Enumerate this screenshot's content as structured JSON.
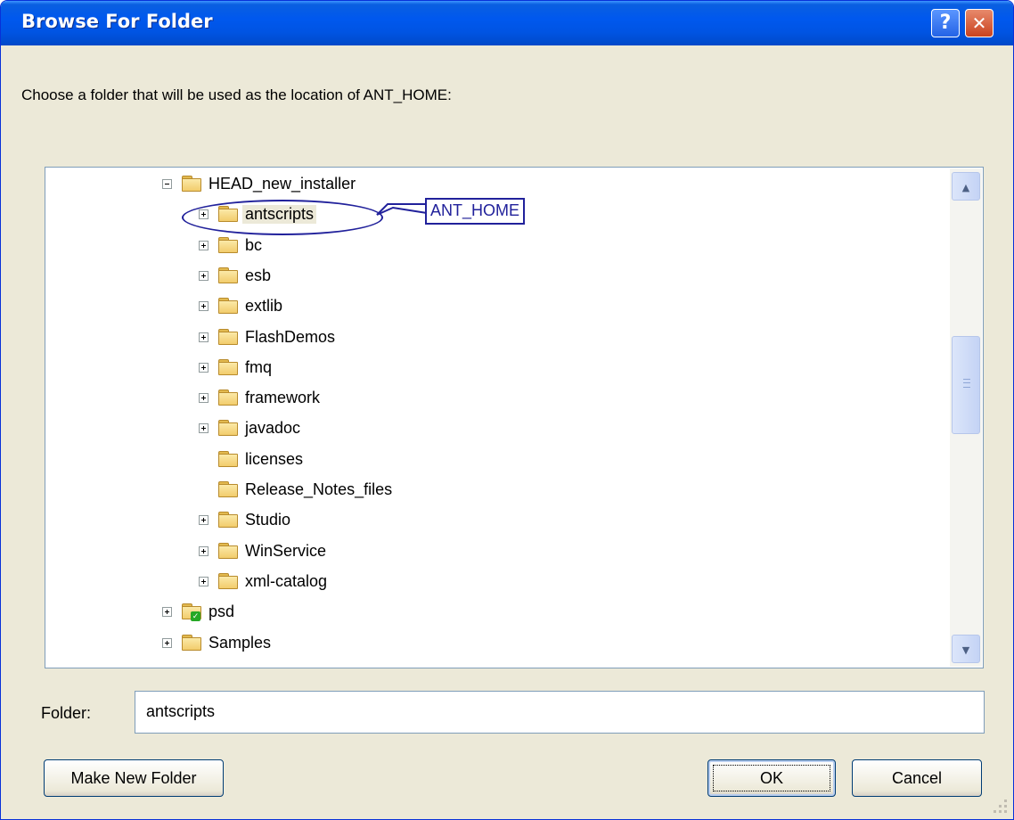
{
  "window": {
    "title": "Browse For Folder",
    "help_glyph": "?",
    "close_glyph": "✕"
  },
  "prompt": "Choose a folder that will be used as the location of ANT_HOME:",
  "tree": {
    "items": [
      {
        "label": "HEAD_new_installer",
        "expander": "minus"
      },
      {
        "label": "antscripts",
        "expander": "plus",
        "selected": true
      },
      {
        "label": "bc",
        "expander": "plus"
      },
      {
        "label": "esb",
        "expander": "plus"
      },
      {
        "label": "extlib",
        "expander": "plus"
      },
      {
        "label": "FlashDemos",
        "expander": "plus"
      },
      {
        "label": "fmq",
        "expander": "plus"
      },
      {
        "label": "framework",
        "expander": "plus"
      },
      {
        "label": "javadoc",
        "expander": "plus"
      },
      {
        "label": "licenses",
        "expander": "none"
      },
      {
        "label": "Release_Notes_files",
        "expander": "none"
      },
      {
        "label": "Studio",
        "expander": "plus"
      },
      {
        "label": "WinService",
        "expander": "plus"
      },
      {
        "label": "xml-catalog",
        "expander": "plus"
      },
      {
        "label": "psd",
        "expander": "plus",
        "icon": "folder-checked-icon"
      },
      {
        "label": "Samples",
        "expander": "plus"
      }
    ]
  },
  "annotation": {
    "callout": "ANT_HOME"
  },
  "folder_field": {
    "label": "Folder:",
    "value": "antscripts"
  },
  "buttons": {
    "make_new_folder": "Make New Folder",
    "ok": "OK",
    "cancel": "Cancel"
  },
  "icons": {
    "scroll_up": "▲",
    "scroll_down": "▼"
  },
  "colors": {
    "titlebar": "#0054e3",
    "dialog_bg": "#ece9d8",
    "annotation": "#21219b"
  }
}
